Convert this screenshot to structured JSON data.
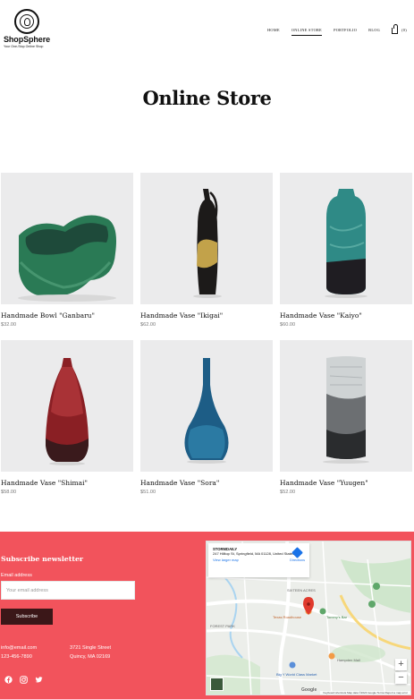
{
  "brand": {
    "name": "ShopSphere",
    "tagline": "Your One-Stop Online Shop"
  },
  "nav": {
    "items": [
      "HOME",
      "ONLINE STORE",
      "PORTFOLIO",
      "BLOG"
    ],
    "active": "ONLINE STORE",
    "cart_count": "(0)"
  },
  "page": {
    "title": "Online Store"
  },
  "products": [
    {
      "name": "Handmade Bowl \"Ganbaru\"",
      "price": "$32.00"
    },
    {
      "name": "Handmade Vase \"Ikigai\"",
      "price": "$62.00"
    },
    {
      "name": "Handmade Vase \"Kaiyo\"",
      "price": "$60.00"
    },
    {
      "name": "Handmade Vase \"Shimai\"",
      "price": "$58.00"
    },
    {
      "name": "Handmade Vase \"Sora\"",
      "price": "$51.00"
    },
    {
      "name": "Handmade Vase \"Yuugen\"",
      "price": "$52.00"
    }
  ],
  "newsletter": {
    "title": "Subscribe newsletter",
    "email_label": "Email address",
    "email_placeholder": "Your email address",
    "button_label": "Subscribe"
  },
  "contact": {
    "email": "info@email.com",
    "phone": "123-456-7890",
    "address_line1": "3721 Single Street",
    "address_line2": "Quincy, MA 02169"
  },
  "socials": [
    "facebook-icon",
    "instagram-icon",
    "twitter-icon"
  ],
  "map": {
    "place_title": "STORMDAILY",
    "place_address": "247 Hilltop St, Springfield, MA 01128, United States",
    "view_larger": "View larger map",
    "directions": "Directions",
    "labels": {
      "sixteen_acres": "SIXTEEN ACRES",
      "texas_roadhouse": "Texas Roadhouse",
      "tommys": "Tommy's Bar",
      "forest_park": "FOREST PARK",
      "six_flags": "Big Y World Class Market",
      "hampden": "Hampden Mall"
    },
    "attribution": "Keyboard shortcuts  Map data ©2024 Google  Terms  Report a map error",
    "google": "Google"
  },
  "colors": {
    "footer_bg": "#f2535c",
    "button_bg": "#3b1718",
    "product_bg": "#e9e9ea"
  }
}
